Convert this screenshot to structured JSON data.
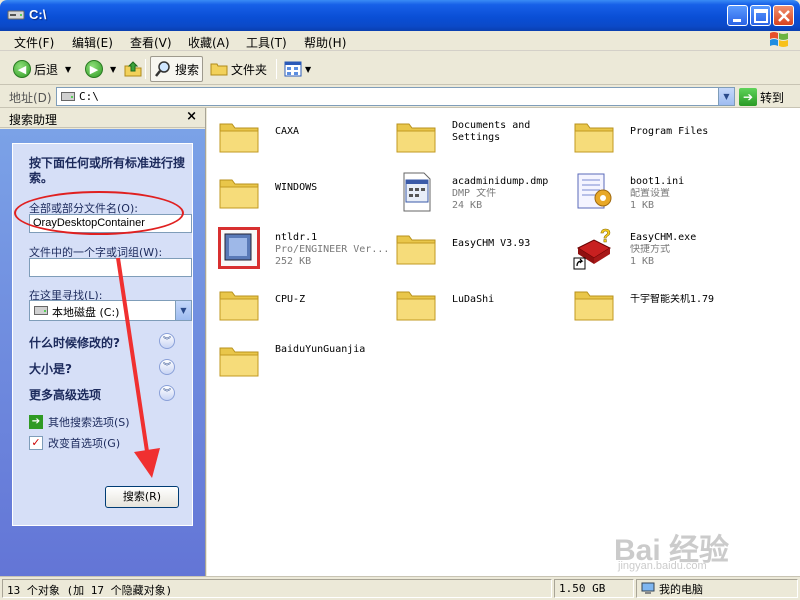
{
  "window": {
    "title": "C:\\"
  },
  "menu": [
    "文件(F)",
    "编辑(E)",
    "查看(V)",
    "收藏(A)",
    "工具(T)",
    "帮助(H)"
  ],
  "toolbar": {
    "back_label": "后退",
    "search_label": "搜索",
    "folders_label": "文件夹"
  },
  "address": {
    "label": "地址(D)",
    "value": "C:\\",
    "go_label": "转到"
  },
  "search_pane": {
    "title": "搜索助理",
    "intro": "按下面任何或所有标准进行搜索。",
    "name_label": "全部或部分文件名(O):",
    "name_value": "OrayDesktopContainer",
    "content_label": "文件中的一个字或词组(W):",
    "content_value": "",
    "look_in_label": "在这里寻找(L):",
    "look_in_value": "本地磁盘 (C:)",
    "section_when": "什么时候修改的?",
    "section_size": "大小是?",
    "section_advanced": "更多高级选项",
    "link_other": "其他搜索选项(S)",
    "link_prefs": "改变首选项(G)",
    "search_button": "搜索(R)"
  },
  "files": [
    {
      "name": "CAXA",
      "type": "folder"
    },
    {
      "name": "Documents and Settings",
      "type": "folder"
    },
    {
      "name": "Program Files",
      "type": "folder"
    },
    {
      "name": "WINDOWS",
      "type": "folder"
    },
    {
      "name": "acadminidump.dmp",
      "type": "dmp",
      "kind": "DMP 文件",
      "size": "24 KB"
    },
    {
      "name": "boot1.ini",
      "type": "ini",
      "kind": "配置设置",
      "size": "1 KB"
    },
    {
      "name": "ntldr.1",
      "type": "proe",
      "kind": "Pro/ENGINEER Ver...",
      "size": "252 KB"
    },
    {
      "name": "EasyCHM V3.93",
      "type": "folder"
    },
    {
      "name": "EasyCHM.exe",
      "type": "shortcut",
      "kind": "快捷方式",
      "size": "1 KB"
    },
    {
      "name": "CPU-Z",
      "type": "folder"
    },
    {
      "name": "LuDaShi",
      "type": "folder"
    },
    {
      "name": "千宇智能关机1.79",
      "type": "folder"
    },
    {
      "name": "BaiduYunGuanjia",
      "type": "folder"
    }
  ],
  "status": {
    "objects": "13 个对象 (加 17 个隐藏对象)",
    "size": "1.50 GB",
    "location": "我的电脑"
  },
  "watermark": {
    "main": "Bai 经验",
    "sub": "jingyan.baidu.com"
  }
}
